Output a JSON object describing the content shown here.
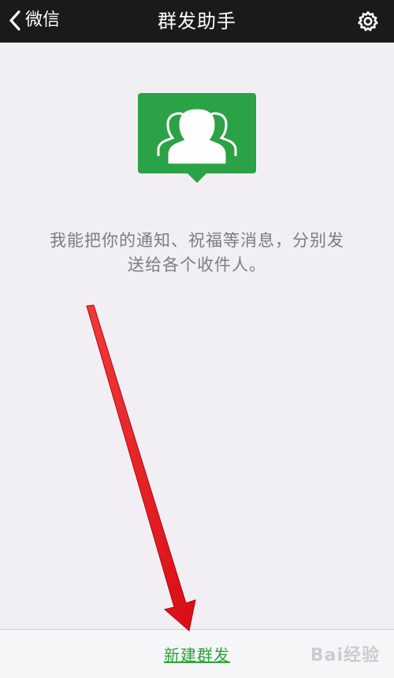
{
  "nav": {
    "back_label": "微信",
    "title": "群发助手"
  },
  "main": {
    "description": "我能把你的通知、祝福等消息，分别发送给各个收件人。"
  },
  "bottom": {
    "new_group_label": "新建群发"
  },
  "watermark": {
    "text": "Bai经验"
  },
  "icons": {
    "back": "chevron-left-icon",
    "settings": "gear-icon",
    "hero": "group-contacts-icon"
  },
  "colors": {
    "nav_background": "#1a1a1a",
    "page_background": "#f1eff4",
    "accent_green": "#2aa437",
    "icon_green": "#2ba245",
    "annotation_arrow": "#e8101a"
  }
}
